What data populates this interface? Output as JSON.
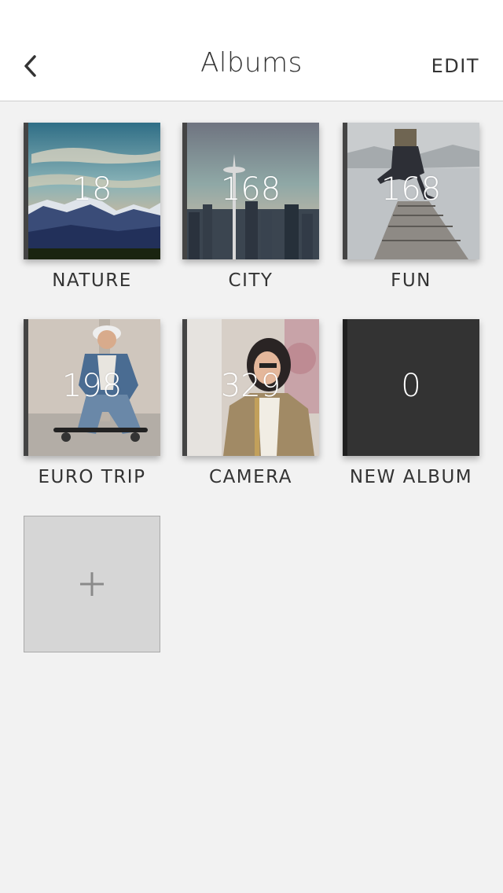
{
  "header": {
    "title": "Albums",
    "edit_label": "EDIT",
    "back_icon": "chevron-left-icon"
  },
  "albums": [
    {
      "name": "NATURE",
      "count": "18",
      "image": "mountain-landscape"
    },
    {
      "name": "CITY",
      "count": "168",
      "image": "city-skyline-space-needle"
    },
    {
      "name": "FUN",
      "count": "168",
      "image": "man-jumping-on-pier"
    },
    {
      "name": "EURO TRIP",
      "count": "198",
      "image": "skater-sitting"
    },
    {
      "name": "CAMERA",
      "count": "329",
      "image": "woman-with-headphones"
    },
    {
      "name": "NEW ALBUM",
      "count": "0",
      "image": "empty-dark"
    }
  ],
  "add_album": {
    "icon": "plus-icon"
  },
  "colors": {
    "background": "#f2f2f2",
    "header_bg": "#ffffff",
    "text": "#333333",
    "new_album_tile": "#333333",
    "add_tile": "#d6d6d6"
  }
}
